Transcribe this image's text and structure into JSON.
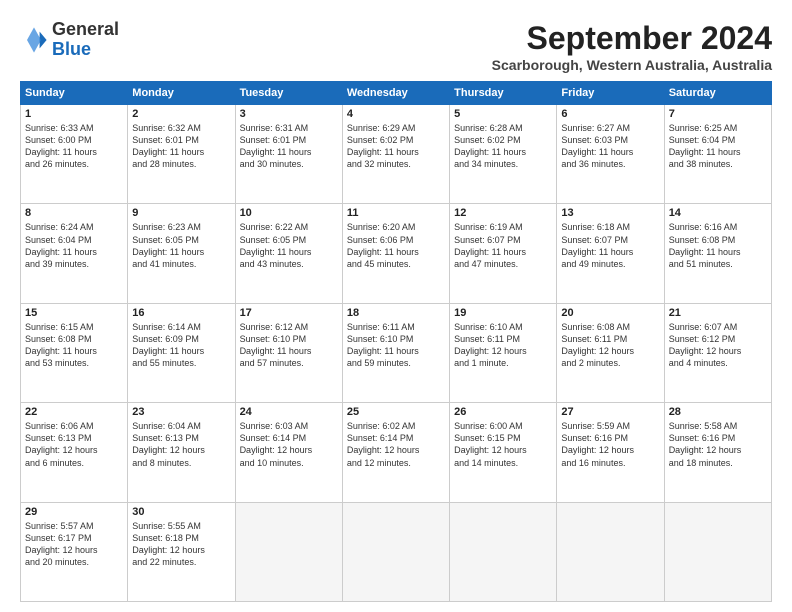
{
  "logo": {
    "general": "General",
    "blue": "Blue"
  },
  "header": {
    "month": "September 2024",
    "location": "Scarborough, Western Australia, Australia"
  },
  "weekdays": [
    "Sunday",
    "Monday",
    "Tuesday",
    "Wednesday",
    "Thursday",
    "Friday",
    "Saturday"
  ],
  "weeks": [
    [
      {
        "day": "1",
        "info": "Sunrise: 6:33 AM\nSunset: 6:00 PM\nDaylight: 11 hours\nand 26 minutes."
      },
      {
        "day": "2",
        "info": "Sunrise: 6:32 AM\nSunset: 6:01 PM\nDaylight: 11 hours\nand 28 minutes."
      },
      {
        "day": "3",
        "info": "Sunrise: 6:31 AM\nSunset: 6:01 PM\nDaylight: 11 hours\nand 30 minutes."
      },
      {
        "day": "4",
        "info": "Sunrise: 6:29 AM\nSunset: 6:02 PM\nDaylight: 11 hours\nand 32 minutes."
      },
      {
        "day": "5",
        "info": "Sunrise: 6:28 AM\nSunset: 6:02 PM\nDaylight: 11 hours\nand 34 minutes."
      },
      {
        "day": "6",
        "info": "Sunrise: 6:27 AM\nSunset: 6:03 PM\nDaylight: 11 hours\nand 36 minutes."
      },
      {
        "day": "7",
        "info": "Sunrise: 6:25 AM\nSunset: 6:04 PM\nDaylight: 11 hours\nand 38 minutes."
      }
    ],
    [
      {
        "day": "8",
        "info": "Sunrise: 6:24 AM\nSunset: 6:04 PM\nDaylight: 11 hours\nand 39 minutes."
      },
      {
        "day": "9",
        "info": "Sunrise: 6:23 AM\nSunset: 6:05 PM\nDaylight: 11 hours\nand 41 minutes."
      },
      {
        "day": "10",
        "info": "Sunrise: 6:22 AM\nSunset: 6:05 PM\nDaylight: 11 hours\nand 43 minutes."
      },
      {
        "day": "11",
        "info": "Sunrise: 6:20 AM\nSunset: 6:06 PM\nDaylight: 11 hours\nand 45 minutes."
      },
      {
        "day": "12",
        "info": "Sunrise: 6:19 AM\nSunset: 6:07 PM\nDaylight: 11 hours\nand 47 minutes."
      },
      {
        "day": "13",
        "info": "Sunrise: 6:18 AM\nSunset: 6:07 PM\nDaylight: 11 hours\nand 49 minutes."
      },
      {
        "day": "14",
        "info": "Sunrise: 6:16 AM\nSunset: 6:08 PM\nDaylight: 11 hours\nand 51 minutes."
      }
    ],
    [
      {
        "day": "15",
        "info": "Sunrise: 6:15 AM\nSunset: 6:08 PM\nDaylight: 11 hours\nand 53 minutes."
      },
      {
        "day": "16",
        "info": "Sunrise: 6:14 AM\nSunset: 6:09 PM\nDaylight: 11 hours\nand 55 minutes."
      },
      {
        "day": "17",
        "info": "Sunrise: 6:12 AM\nSunset: 6:10 PM\nDaylight: 11 hours\nand 57 minutes."
      },
      {
        "day": "18",
        "info": "Sunrise: 6:11 AM\nSunset: 6:10 PM\nDaylight: 11 hours\nand 59 minutes."
      },
      {
        "day": "19",
        "info": "Sunrise: 6:10 AM\nSunset: 6:11 PM\nDaylight: 12 hours\nand 1 minute."
      },
      {
        "day": "20",
        "info": "Sunrise: 6:08 AM\nSunset: 6:11 PM\nDaylight: 12 hours\nand 2 minutes."
      },
      {
        "day": "21",
        "info": "Sunrise: 6:07 AM\nSunset: 6:12 PM\nDaylight: 12 hours\nand 4 minutes."
      }
    ],
    [
      {
        "day": "22",
        "info": "Sunrise: 6:06 AM\nSunset: 6:13 PM\nDaylight: 12 hours\nand 6 minutes."
      },
      {
        "day": "23",
        "info": "Sunrise: 6:04 AM\nSunset: 6:13 PM\nDaylight: 12 hours\nand 8 minutes."
      },
      {
        "day": "24",
        "info": "Sunrise: 6:03 AM\nSunset: 6:14 PM\nDaylight: 12 hours\nand 10 minutes."
      },
      {
        "day": "25",
        "info": "Sunrise: 6:02 AM\nSunset: 6:14 PM\nDaylight: 12 hours\nand 12 minutes."
      },
      {
        "day": "26",
        "info": "Sunrise: 6:00 AM\nSunset: 6:15 PM\nDaylight: 12 hours\nand 14 minutes."
      },
      {
        "day": "27",
        "info": "Sunrise: 5:59 AM\nSunset: 6:16 PM\nDaylight: 12 hours\nand 16 minutes."
      },
      {
        "day": "28",
        "info": "Sunrise: 5:58 AM\nSunset: 6:16 PM\nDaylight: 12 hours\nand 18 minutes."
      }
    ],
    [
      {
        "day": "29",
        "info": "Sunrise: 5:57 AM\nSunset: 6:17 PM\nDaylight: 12 hours\nand 20 minutes."
      },
      {
        "day": "30",
        "info": "Sunrise: 5:55 AM\nSunset: 6:18 PM\nDaylight: 12 hours\nand 22 minutes."
      },
      {
        "day": "",
        "info": ""
      },
      {
        "day": "",
        "info": ""
      },
      {
        "day": "",
        "info": ""
      },
      {
        "day": "",
        "info": ""
      },
      {
        "day": "",
        "info": ""
      }
    ]
  ]
}
